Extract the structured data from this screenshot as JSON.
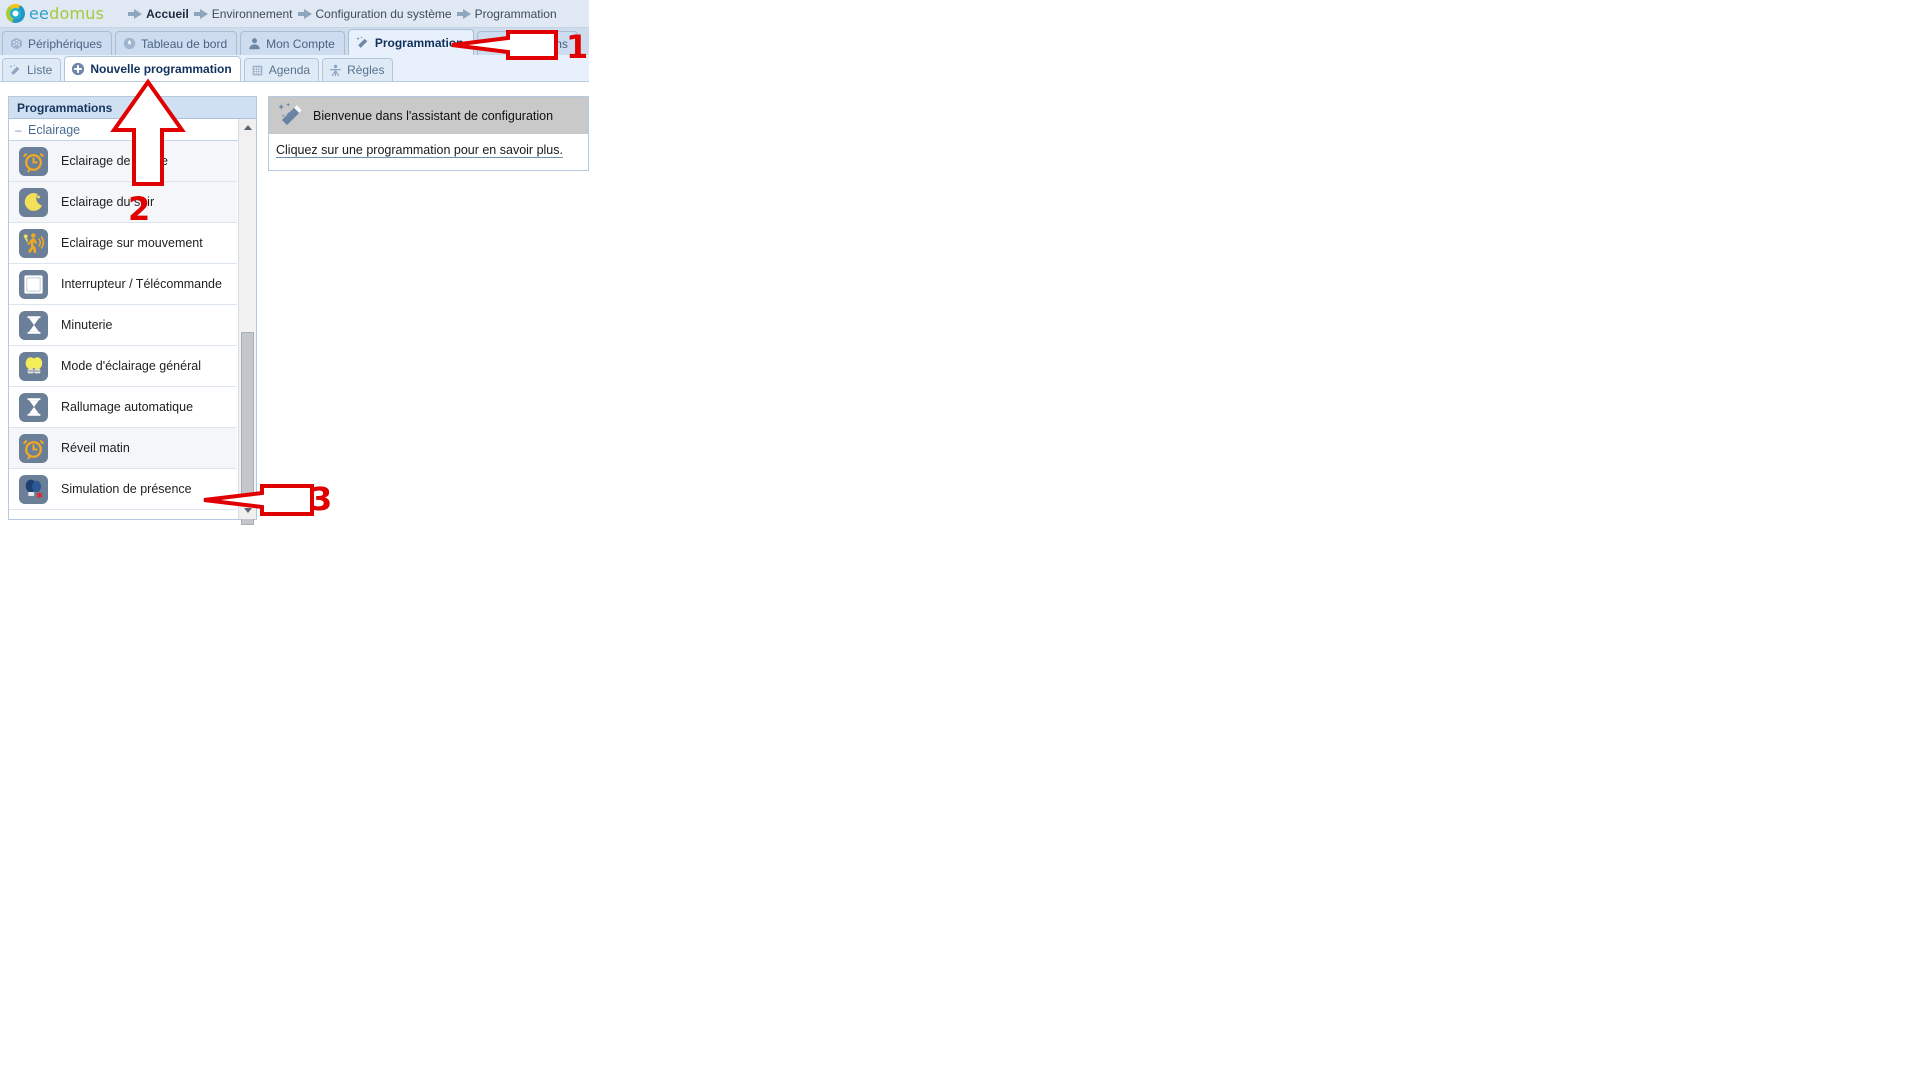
{
  "brand": {
    "name_part_a": "ee",
    "name_part_b": "domus",
    "logo_icon": "eedomus-ring-logo"
  },
  "breadcrumb": {
    "items": [
      {
        "label": "Accueil",
        "current": true
      },
      {
        "label": "Environnement",
        "current": false
      },
      {
        "label": "Configuration du système",
        "current": false
      },
      {
        "label": "Programmation",
        "current": false
      }
    ]
  },
  "primary_tabs": [
    {
      "label": "Périphériques",
      "icon": "devices-cube-icon",
      "active": false
    },
    {
      "label": "Tableau de bord",
      "icon": "gauge-icon",
      "active": false
    },
    {
      "label": "Mon Compte",
      "icon": "user-icon",
      "active": false
    },
    {
      "label": "Programmation",
      "icon": "magic-wand-icon",
      "active": true
    },
    {
      "label": "Notifications",
      "icon": "megaphone-icon",
      "active": false
    }
  ],
  "secondary_tabs": [
    {
      "label": "Liste",
      "icon": "magic-wand-icon",
      "active": false
    },
    {
      "label": "Nouvelle programmation",
      "icon": "plus-circle-icon",
      "active": true
    },
    {
      "label": "Agenda",
      "icon": "calendar-building-icon",
      "active": false
    },
    {
      "label": "Règles",
      "icon": "rules-person-icon",
      "active": false
    }
  ],
  "sidebar": {
    "header": "Programmations",
    "group": {
      "label": "Eclairage",
      "collapse_glyph": "–"
    },
    "items": [
      {
        "label": "Eclairage de soirée",
        "icon": "alarm-clock-icon"
      },
      {
        "label": "Eclairage du soir",
        "icon": "moon-icon"
      },
      {
        "label": "Eclairage sur mouvement",
        "icon": "motion-sensor-icon"
      },
      {
        "label": "Interrupteur / Télécommande",
        "icon": "switch-icon"
      },
      {
        "label": "Minuterie",
        "icon": "hourglass-icon"
      },
      {
        "label": "Mode d'éclairage général",
        "icon": "two-bulbs-icon"
      },
      {
        "label": "Rallumage automatique",
        "icon": "hourglass-icon"
      },
      {
        "label": "Réveil matin",
        "icon": "alarm-clock-icon"
      },
      {
        "label": "Simulation de présence",
        "icon": "presence-simulation-icon"
      }
    ],
    "scrollbar": {
      "up_icon": "chevron-up-icon",
      "down_icon": "chevron-down-icon"
    }
  },
  "main_panel": {
    "banner_icon": "magic-wand-icon",
    "banner_title": "Bienvenue dans l'assistant de configuration",
    "body_text_before": "Cliquez sur une programmation pour ",
    "body_text_link1": "en savoir",
    "body_text_link2": " plus."
  },
  "annotations": [
    {
      "number": "1",
      "target": "programmation-primary-tab",
      "direction": "left"
    },
    {
      "number": "2",
      "target": "nouvelle-programmation-secondary-tab",
      "direction": "up"
    },
    {
      "number": "3",
      "target": "simulation-de-presence-item",
      "direction": "left"
    }
  ],
  "colors": {
    "annotation_red": "#e00000",
    "active_tab_text": "#10305e",
    "brand_blue": "#2f9fd0",
    "brand_green": "#a5c93c",
    "sidebar_header_bg": "#cfe0f2",
    "banner_bg": "#c9c9c9"
  }
}
